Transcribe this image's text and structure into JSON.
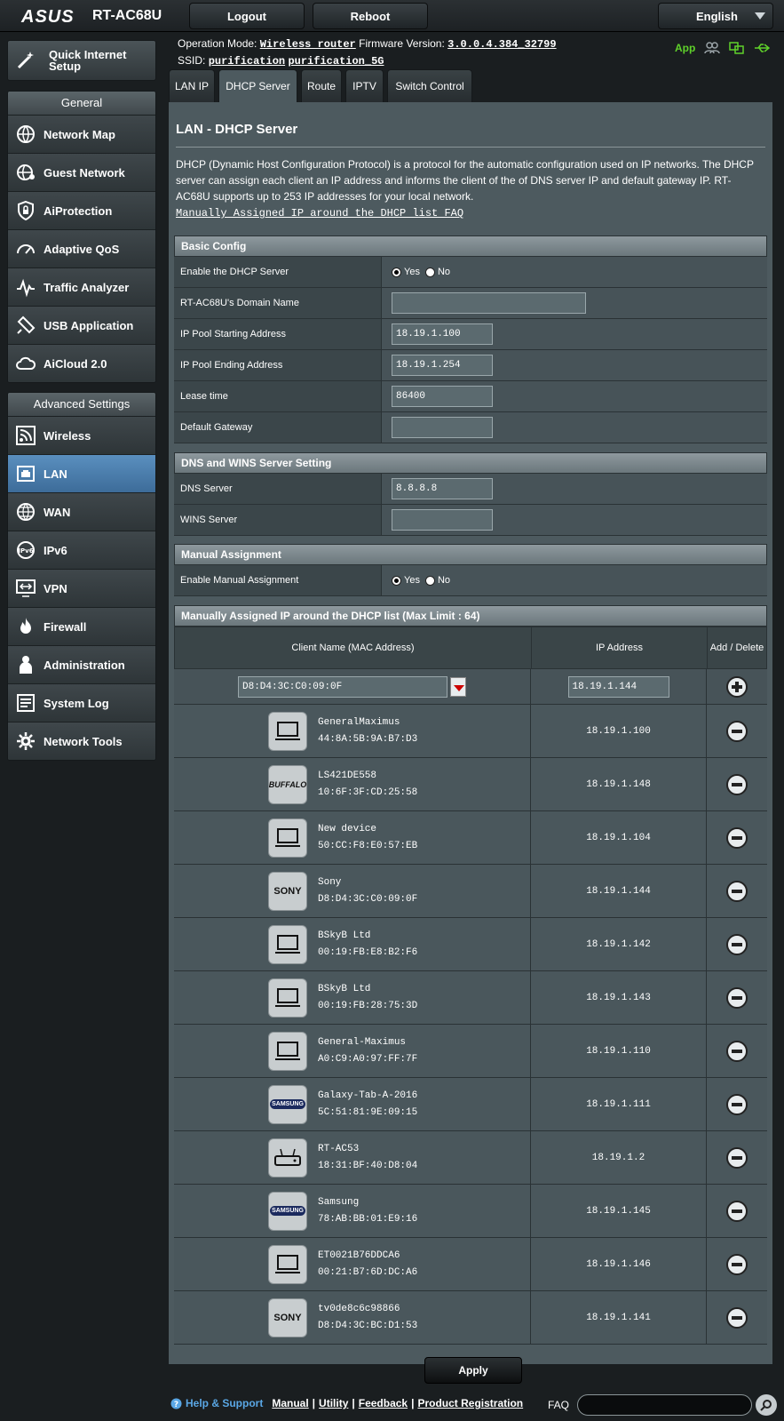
{
  "topbar": {
    "logo": "ASUS",
    "model": "RT-AC68U",
    "logout": "Logout",
    "reboot": "Reboot",
    "language": "English"
  },
  "status": {
    "op_mode_label": "Operation Mode:",
    "op_mode": "Wireless router",
    "fw_label": "Firmware Version:",
    "fw": "3.0.0.4.384_32799",
    "ssid_label": "SSID:",
    "ssid1": "purification",
    "ssid2": "purification_5G",
    "app_label": "App"
  },
  "sidebar": {
    "qis": "Quick Internet Setup",
    "general_title": "General",
    "general": [
      "Network Map",
      "Guest Network",
      "AiProtection",
      "Adaptive QoS",
      "Traffic Analyzer",
      "USB Application",
      "AiCloud 2.0"
    ],
    "advanced_title": "Advanced Settings",
    "advanced": [
      "Wireless",
      "LAN",
      "WAN",
      "IPv6",
      "VPN",
      "Firewall",
      "Administration",
      "System Log",
      "Network Tools"
    ]
  },
  "tabs": [
    "LAN IP",
    "DHCP Server",
    "Route",
    "IPTV",
    "Switch Control"
  ],
  "page": {
    "title": "LAN - DHCP Server",
    "description": "DHCP (Dynamic Host Configuration Protocol) is a protocol for the automatic configuration used on IP networks. The DHCP server can assign each client an IP address and informs the client of the of DNS server IP and default gateway IP. RT-AC68U supports up to 253 IP addresses for your local network.",
    "faq_link": "Manually Assigned IP around the DHCP list FAQ"
  },
  "basic": {
    "title": "Basic Config",
    "enable_label": "Enable the DHCP Server",
    "yes": "Yes",
    "no": "No",
    "domain_label": "RT-AC68U's Domain Name",
    "domain": "",
    "start_label": "IP Pool Starting Address",
    "start": "18.19.1.100",
    "end_label": "IP Pool Ending Address",
    "end": "18.19.1.254",
    "lease_label": "Lease time",
    "lease": "86400",
    "gw_label": "Default Gateway",
    "gw": ""
  },
  "dns": {
    "title": "DNS and WINS Server Setting",
    "dns_label": "DNS Server",
    "dns": "8.8.8.8",
    "wins_label": "WINS Server",
    "wins": ""
  },
  "manual": {
    "title": "Manual Assignment",
    "enable_label": "Enable Manual Assignment",
    "yes": "Yes",
    "no": "No"
  },
  "list": {
    "title": "Manually Assigned IP around the DHCP list (Max Limit : 64)",
    "col_client": "Client Name (MAC Address)",
    "col_ip": "IP Address",
    "col_action": "Add / Delete",
    "new_mac": "D8:D4:3C:C0:09:0F",
    "new_ip": "18.19.1.144",
    "rows": [
      {
        "name": "GeneralMaximus",
        "mac": "44:8A:5B:9A:B7:D3",
        "ip": "18.19.1.100",
        "icon": "laptop"
      },
      {
        "name": "LS421DE558",
        "mac": "10:6F:3F:CD:25:58",
        "ip": "18.19.1.148",
        "icon": "buffalo"
      },
      {
        "name": "New device",
        "mac": "50:CC:F8:E0:57:EB",
        "ip": "18.19.1.104",
        "icon": "laptop"
      },
      {
        "name": "Sony",
        "mac": "D8:D4:3C:C0:09:0F",
        "ip": "18.19.1.144",
        "icon": "sony"
      },
      {
        "name": "BSkyB Ltd",
        "mac": "00:19:FB:E8:B2:F6",
        "ip": "18.19.1.142",
        "icon": "laptop"
      },
      {
        "name": "BSkyB Ltd",
        "mac": "00:19:FB:28:75:3D",
        "ip": "18.19.1.143",
        "icon": "laptop"
      },
      {
        "name": "General-Maximus",
        "mac": "A0:C9:A0:97:FF:7F",
        "ip": "18.19.1.110",
        "icon": "laptop"
      },
      {
        "name": "Galaxy-Tab-A-2016",
        "mac": "5C:51:81:9E:09:15",
        "ip": "18.19.1.111",
        "icon": "samsung"
      },
      {
        "name": "RT-AC53",
        "mac": "18:31:BF:40:D8:04",
        "ip": "18.19.1.2",
        "icon": "router"
      },
      {
        "name": "Samsung",
        "mac": "78:AB:BB:01:E9:16",
        "ip": "18.19.1.145",
        "icon": "samsung"
      },
      {
        "name": "ET0021B76DDCA6",
        "mac": "00:21:B7:6D:DC:A6",
        "ip": "18.19.1.146",
        "icon": "laptop"
      },
      {
        "name": "tv0de8c6c98866",
        "mac": "D8:D4:3C:BC:D1:53",
        "ip": "18.19.1.141",
        "icon": "sony"
      }
    ]
  },
  "brands": {
    "buffalo": "BUFFALO",
    "sony": "SONY",
    "samsung": "SAMSUNG"
  },
  "apply": "Apply",
  "footer": {
    "help": "Help & Support",
    "manual": "Manual",
    "utility": "Utility",
    "feedback": "Feedback",
    "registration": "Product Registration",
    "faq": "FAQ"
  },
  "colors": {
    "active_nav": "#4a7fb0",
    "content_bg": "#4d5a5f",
    "app_green": "#5fd12a"
  }
}
